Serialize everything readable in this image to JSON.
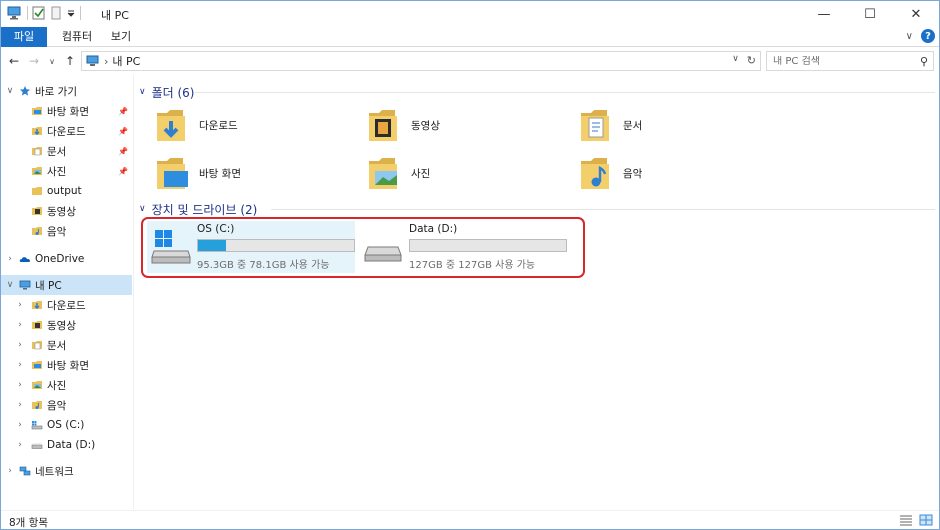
{
  "window": {
    "title": "내 PC",
    "controls": {
      "minimize": "—",
      "maximize": "☐",
      "close": "✕"
    }
  },
  "ribbon": {
    "tabs": [
      "파일",
      "컴퓨터",
      "보기"
    ],
    "expand": "∨",
    "help": "?"
  },
  "navbar": {
    "back": "←",
    "forward": "→",
    "recent": "∨",
    "up": "↑",
    "address_path": "내 PC",
    "address_separator": "›",
    "search_placeholder": "내 PC 검색"
  },
  "nav_pane": {
    "quick_access": {
      "label": "바로 가기",
      "items": [
        {
          "label": "바탕 화면",
          "icon": "desktop-folder-icon",
          "pinned": true
        },
        {
          "label": "다운로드",
          "icon": "downloads-folder-icon",
          "pinned": true
        },
        {
          "label": "문서",
          "icon": "documents-folder-icon",
          "pinned": true
        },
        {
          "label": "사진",
          "icon": "pictures-folder-icon",
          "pinned": true
        },
        {
          "label": "output",
          "icon": "folder-icon",
          "pinned": false
        },
        {
          "label": "동영상",
          "icon": "videos-folder-icon",
          "pinned": false
        },
        {
          "label": "음악",
          "icon": "music-folder-icon",
          "pinned": false
        }
      ]
    },
    "onedrive": {
      "label": "OneDrive"
    },
    "this_pc": {
      "label": "내 PC",
      "items": [
        {
          "label": "다운로드",
          "icon": "downloads-folder-icon"
        },
        {
          "label": "동영상",
          "icon": "videos-folder-icon"
        },
        {
          "label": "문서",
          "icon": "documents-folder-icon"
        },
        {
          "label": "바탕 화면",
          "icon": "desktop-folder-icon"
        },
        {
          "label": "사진",
          "icon": "pictures-folder-icon"
        },
        {
          "label": "음악",
          "icon": "music-folder-icon"
        },
        {
          "label": "OS (C:)",
          "icon": "os-drive-icon"
        },
        {
          "label": "Data (D:)",
          "icon": "data-drive-icon"
        }
      ]
    },
    "network": {
      "label": "네트워크"
    }
  },
  "content": {
    "folders_group": {
      "label": "폴더 (6)",
      "items": [
        {
          "label": "다운로드",
          "icon": "downloads-folder-icon"
        },
        {
          "label": "동영상",
          "icon": "videos-folder-icon"
        },
        {
          "label": "문서",
          "icon": "documents-folder-icon"
        },
        {
          "label": "바탕 화면",
          "icon": "desktop-folder-icon"
        },
        {
          "label": "사진",
          "icon": "pictures-folder-icon"
        },
        {
          "label": "음악",
          "icon": "music-folder-icon"
        }
      ]
    },
    "drives_group": {
      "label": "장치 및 드라이브 (2)",
      "items": [
        {
          "label": "OS (C:)",
          "free_text": "95.3GB 중 78.1GB 사용 가능",
          "used_fraction": 0.18,
          "selected": true
        },
        {
          "label": "Data (D:)",
          "free_text": "127GB 중 127GB 사용 가능",
          "used_fraction": 0.0,
          "selected": false
        }
      ]
    }
  },
  "status": {
    "item_count": "8개 항목"
  },
  "colors": {
    "accent": "#1a6fc8",
    "selection": "#cce4f7",
    "drive_fill": "#26a0da",
    "highlight_outline": "#d9262b",
    "group_header": "#1e3287"
  }
}
